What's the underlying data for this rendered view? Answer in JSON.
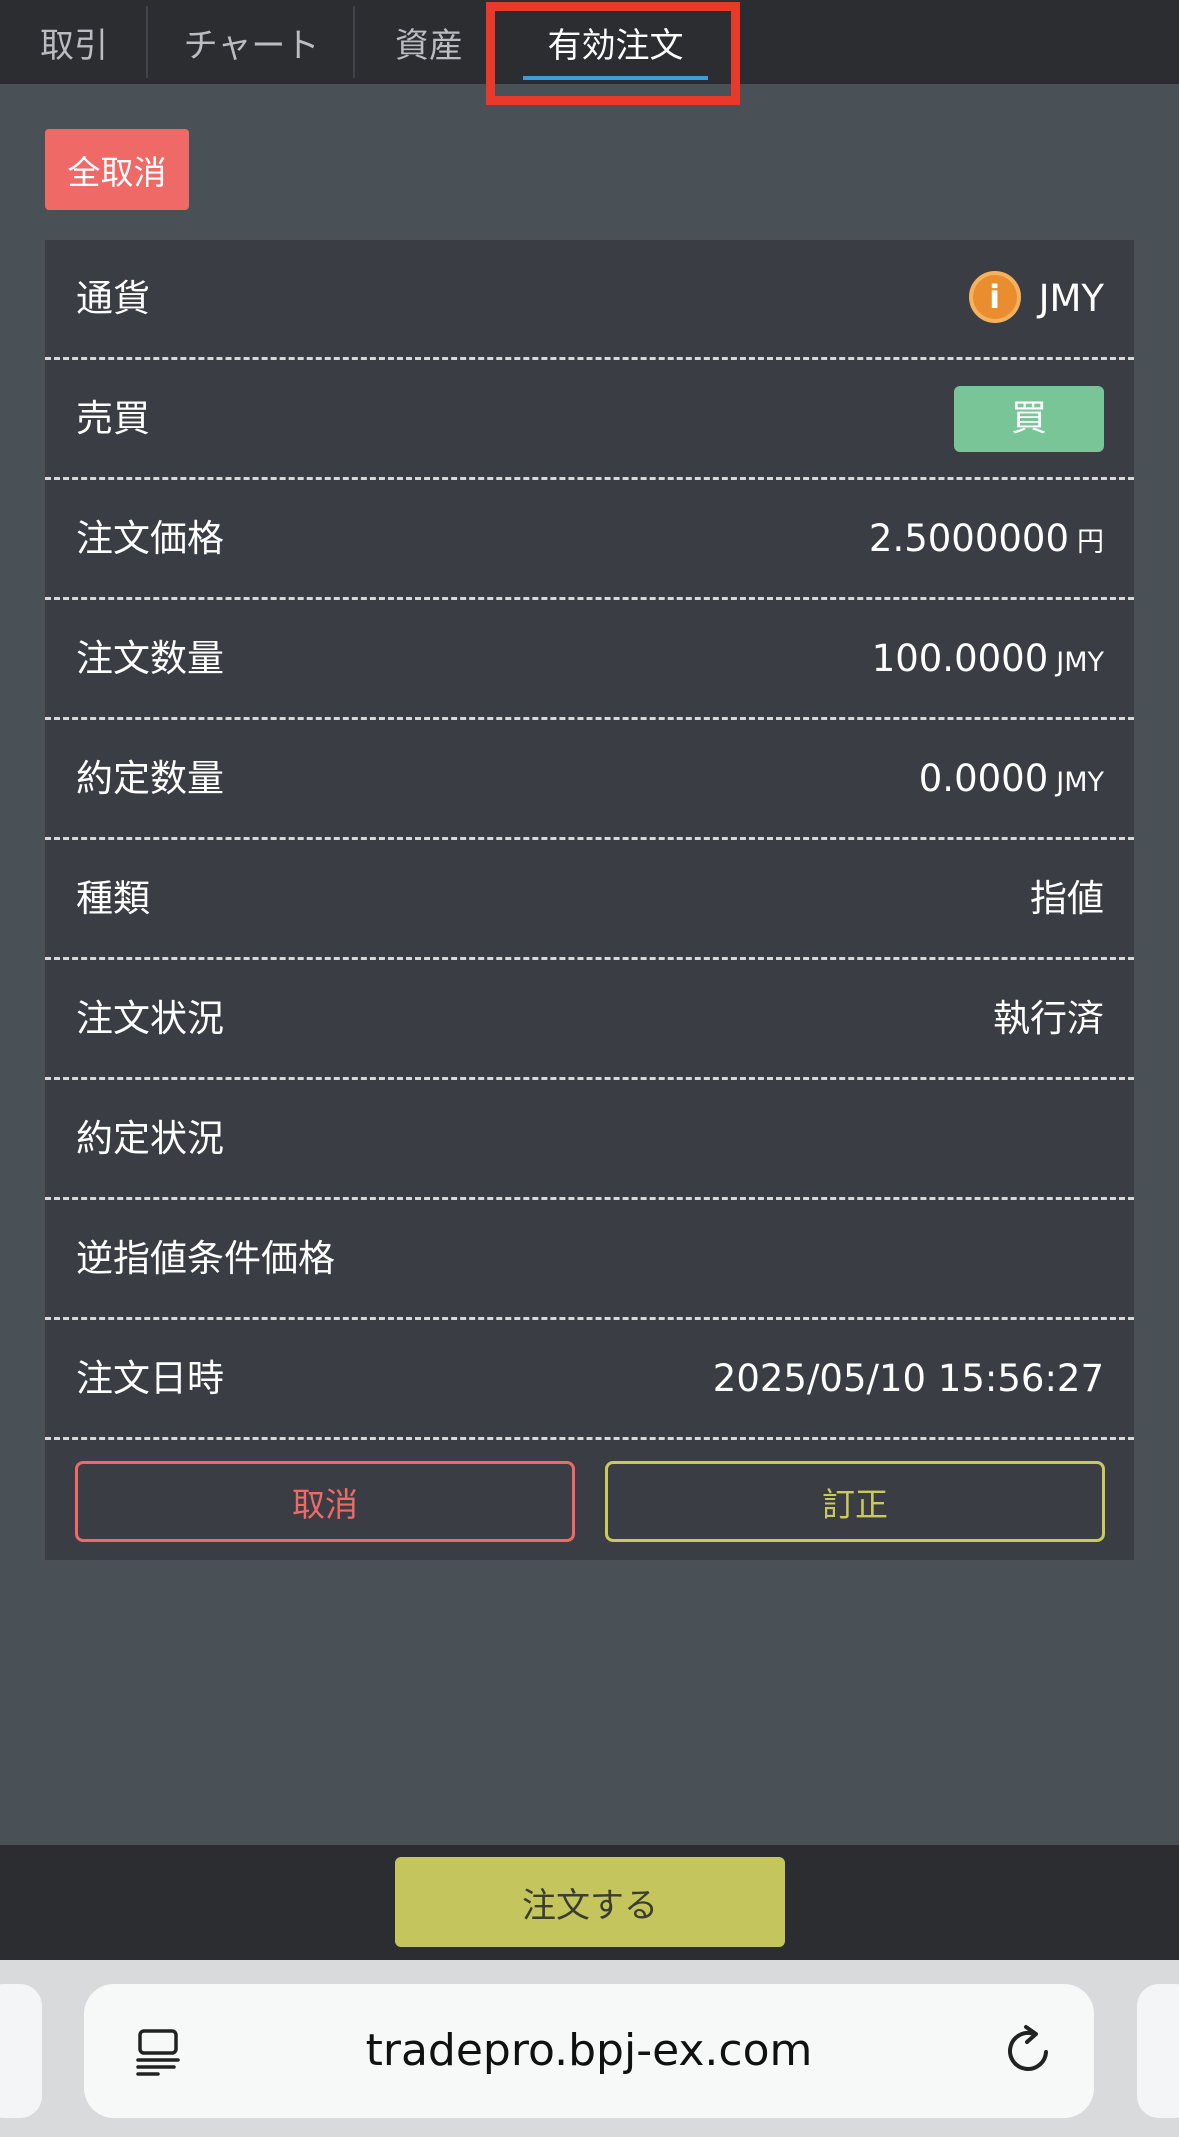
{
  "tabs": [
    {
      "label": "取引"
    },
    {
      "label": "チャート"
    },
    {
      "label": "資産"
    },
    {
      "label": "有効注文",
      "active": true
    }
  ],
  "cancel_all_label": "全取消",
  "order": {
    "currency": {
      "label": "通貨",
      "value": "JMY",
      "icon": "jmy-coin-icon"
    },
    "side": {
      "label": "売買",
      "value": "買"
    },
    "price": {
      "label": "注文価格",
      "value": "2.5000000",
      "unit": "円"
    },
    "quantity": {
      "label": "注文数量",
      "value": "100.0000",
      "unit": "JMY"
    },
    "filled_quantity": {
      "label": "約定数量",
      "value": "0.0000",
      "unit": "JMY"
    },
    "type": {
      "label": "種類",
      "value": "指値"
    },
    "status": {
      "label": "注文状況",
      "value": "執行済"
    },
    "fill_status": {
      "label": "約定状況",
      "value": ""
    },
    "stop_price": {
      "label": "逆指値条件価格",
      "value": ""
    },
    "datetime": {
      "label": "注文日時",
      "value": "2025/05/10 15:56:27"
    }
  },
  "actions": {
    "cancel_label": "取消",
    "amend_label": "訂正"
  },
  "bottom": {
    "order_button_label": "注文する"
  },
  "browser": {
    "url": "tradepro.bpj-ex.com"
  },
  "colors": {
    "highlight": "#e8392b",
    "cancel": "#ef6a67",
    "buy": "#79c598",
    "amend": "#c9c95d",
    "order_button": "#c4c65d",
    "active_tab_underline": "#3a9fd8"
  }
}
